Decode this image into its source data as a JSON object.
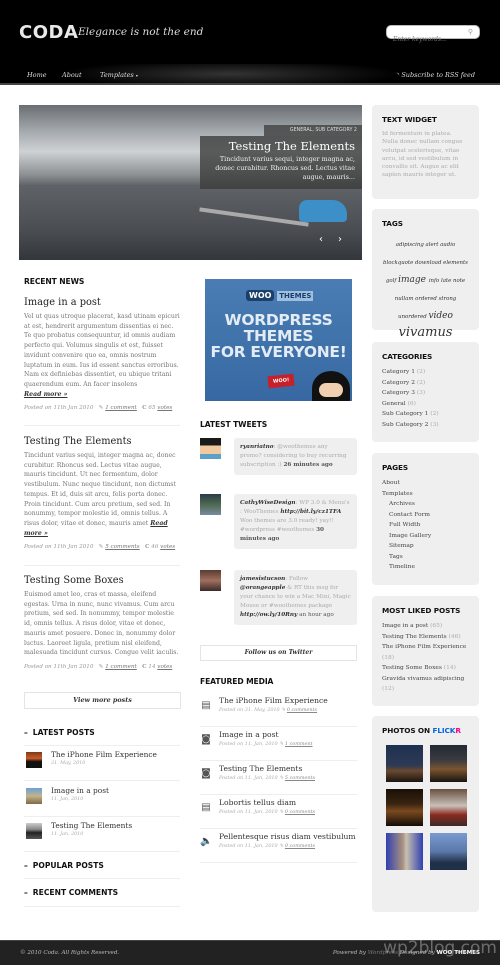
{
  "header": {
    "logo": "CODA",
    "tagline": "Elegance is not the end",
    "search_placeholder": "Enter keywords...",
    "nav": [
      "Home",
      "About",
      "Templates"
    ],
    "nav_dropdown_indicator": "▾",
    "rss_label": "Subscribe to RSS feed"
  },
  "slider": {
    "categories": "GENERAL, SUB CATEGORY 2",
    "title": "Testing The Elements",
    "excerpt": "Tincidunt varius sequi, integer magna ac, donec curabitur. Rhoncus sed. Lectus vitae augue, mauris...",
    "prev": "‹",
    "next": "›"
  },
  "recent_news": {
    "heading": "RECENT NEWS",
    "read_more": "Read more »",
    "posts": [
      {
        "title": "Image in a post",
        "excerpt": "Vel ut quas utroque placerat, kasd utinam epicuri at est, hendrerit argumentum dissentias ei nec. Te quo probatus consequuntur, id omnis audiam perfecto qui. Volumus singulis et est, fuisset invidunt convenire quo ea, omnis nostrum luptatum in eum. Ius id essent sanctus erroribus. Nam ex definiebas dissentiet, eu ubique tritani quaerendum eum. An facer insolens",
        "posted": "Posted on 11th Jan 2010",
        "comments": "1 comment",
        "votes_count": "65",
        "votes_label": "votes"
      },
      {
        "title": "Testing The Elements",
        "excerpt": "Tincidunt varius sequi, integer magna ac, donec curabitur. Rhoncus sed. Lectus vitae augue, mauris tincidunt. Ut nec fermentum, dolor vestibulum. Nunc neque tincidunt, non dictumst tempus. Et id, duis sit arcu, felis porta donec. Proin tincidunt. Cum arcu pretium, sed sed. In nonummy, tempor molestie id, omnis tellus. A risus dolor, vitae et donec, mauris amet",
        "posted": "Posted on 11th Jan 2010",
        "comments": "5 comments",
        "votes_count": "46",
        "votes_label": "votes"
      },
      {
        "title": "Testing Some Boxes",
        "excerpt": "Euismod amet leo, cras et massa, eleifend egestas. Urna in nunc, nunc vivamus. Cum arcu pretium, sed sed. In nonummy, tempor molestie id, omnis tellus. A risus dolor, vitae et donec, mauris amet posuere. Donec in, nonummy dolor luctus. Laoreet ligula, pretium nisl eleifend, malesuada tincidunt cursus. Congue velit iaculis.",
        "posted": "Posted on 11th Jan 2010",
        "comments": "1 comment",
        "votes_count": "14",
        "votes_label": "votes"
      }
    ],
    "view_more": "View more posts"
  },
  "tabs": {
    "latest_posts": {
      "heading": "LATEST POSTS",
      "items": [
        {
          "title": "The iPhone Film Experience",
          "date": "31. May, 2010"
        },
        {
          "title": "Image in a post",
          "date": "11. Jan, 2010"
        },
        {
          "title": "Testing The Elements",
          "date": "11. Jan, 2010"
        }
      ]
    },
    "popular_posts": {
      "heading": "POPULAR POSTS"
    },
    "recent_comments": {
      "heading": "RECENT COMMENTS"
    }
  },
  "ad": {
    "logo_woo": "WOO",
    "logo_themes": "THEMES",
    "lines": [
      "WORDPRESS",
      "THEMES",
      "FOR EVERYONE!"
    ],
    "badge": "WOO!"
  },
  "tweets": {
    "heading": "LATEST TWEETS",
    "items": [
      {
        "user": "ryanriatno",
        "text": ": @woothemes any promo? considering to buy recurring subscription :) ",
        "time": "26 minutes ago"
      },
      {
        "user": "CathyWiseDesign",
        "text": ": WP 3.0 & Menu's : WooThemes ",
        "link": "http://bit.ly/cz1TFA",
        "text2": " Woo themes are 3.0 ready! yay!! #wordpress #woothemes ",
        "time": "30 minutes ago"
      },
      {
        "user": "jamesistucson",
        "text": ": Follow ",
        "mention": "@orangeapple",
        "text2": " & RT this msg for your chance to win a Mac Mini, Magic Mouse or #woothemes package ",
        "link": "http://ow.ly/10Rny",
        "time": "an hour ago"
      }
    ],
    "follow": "Follow us on Twitter"
  },
  "featured_media": {
    "heading": "FEATURED MEDIA",
    "items": [
      {
        "type": "film",
        "title": "The iPhone Film Experience",
        "posted": "Posted on 31. May, 2010",
        "comments": "0 comments"
      },
      {
        "type": "camera",
        "title": "Image in a post",
        "posted": "Posted on 11. Jan, 2010",
        "comments": "1 comment"
      },
      {
        "type": "camera",
        "title": "Testing The Elements",
        "posted": "Posted on 11. Jan, 2010",
        "comments": "5 comments"
      },
      {
        "type": "film",
        "title": "Lobortis tellus diam",
        "posted": "Posted on 11. Jan, 2010",
        "comments": "0 comments"
      },
      {
        "type": "audio",
        "title": "Pellentesque risus diam vestibulum",
        "posted": "Posted on 11. Jan, 2010",
        "comments": "0 comments"
      }
    ]
  },
  "sidebar": {
    "text_widget": {
      "heading": "TEXT WIDGET",
      "body": "Id fermentum in platea. Nulla donec nullam congue volutpat scelerisque, vitae arcu, id sed vestibulum in convallis sit. Augue ac elit sapien mauris integer ut."
    },
    "tags": {
      "heading": "TAGS",
      "items": [
        {
          "label": "adipiscing",
          "size": "small"
        },
        {
          "label": "alert",
          "size": "small"
        },
        {
          "label": "audio",
          "size": "small"
        },
        {
          "label": "blockquote",
          "size": "small"
        },
        {
          "label": "download",
          "size": "small"
        },
        {
          "label": "elements",
          "size": "small"
        },
        {
          "label": "golf",
          "size": "small"
        },
        {
          "label": "image",
          "size": "medium"
        },
        {
          "label": "info",
          "size": "small"
        },
        {
          "label": "late",
          "size": "small"
        },
        {
          "label": "note",
          "size": "small"
        },
        {
          "label": "nullam",
          "size": "small"
        },
        {
          "label": "ordered",
          "size": "small"
        },
        {
          "label": "strong",
          "size": "small"
        },
        {
          "label": "unordered",
          "size": "small"
        },
        {
          "label": "video",
          "size": "medium"
        },
        {
          "label": "vivamus",
          "size": "large"
        }
      ]
    },
    "categories": {
      "heading": "CATEGORIES",
      "items": [
        {
          "label": "Category 1",
          "count": "(2)"
        },
        {
          "label": "Category 2",
          "count": "(2)"
        },
        {
          "label": "Category 3",
          "count": "(3)"
        },
        {
          "label": "General",
          "count": "(6)"
        },
        {
          "label": "Sub Category 1",
          "count": "(2)"
        },
        {
          "label": "Sub Category 2",
          "count": "(3)"
        }
      ]
    },
    "pages": {
      "heading": "PAGES",
      "items": [
        {
          "label": "About",
          "sub": false
        },
        {
          "label": "Templates",
          "sub": false
        },
        {
          "label": "Archives",
          "sub": true
        },
        {
          "label": "Contact Form",
          "sub": true
        },
        {
          "label": "Full Width",
          "sub": true
        },
        {
          "label": "Image Gallery",
          "sub": true
        },
        {
          "label": "Sitemap",
          "sub": true
        },
        {
          "label": "Tags",
          "sub": true
        },
        {
          "label": "Timeline",
          "sub": true
        }
      ]
    },
    "most_liked": {
      "heading": "MOST LIKED POSTS",
      "items": [
        {
          "label": "Image in a post",
          "count": "(65)"
        },
        {
          "label": "Testing The Elements",
          "count": "(46)"
        },
        {
          "label": "The iPhone Film Experience",
          "count": "(18)"
        },
        {
          "label": "Testing Some Boxes",
          "count": "(14)"
        },
        {
          "label": "Gravida vivamus adipiscing",
          "count": "(12)"
        }
      ]
    },
    "flickr": {
      "heading_prefix": "PHOTOS ON ",
      "brand_flick": "FLICK",
      "brand_r": "R",
      "brand_blue": "#0063dc",
      "brand_pink": "#ff0084",
      "photos": [
        "night-street-1",
        "night-street-2",
        "cnn-sign",
        "cable-car",
        "tower-blue",
        "harbor-dusk"
      ]
    }
  },
  "footer": {
    "copyright": "© 2010 Coda. All Rights Reserved.",
    "powered_prefix": "Powered by",
    "powered_wp": "Wordpress",
    "designed_by": "Designed by",
    "brand": "WOO THEMES",
    "watermark": "wp2blog.com"
  }
}
